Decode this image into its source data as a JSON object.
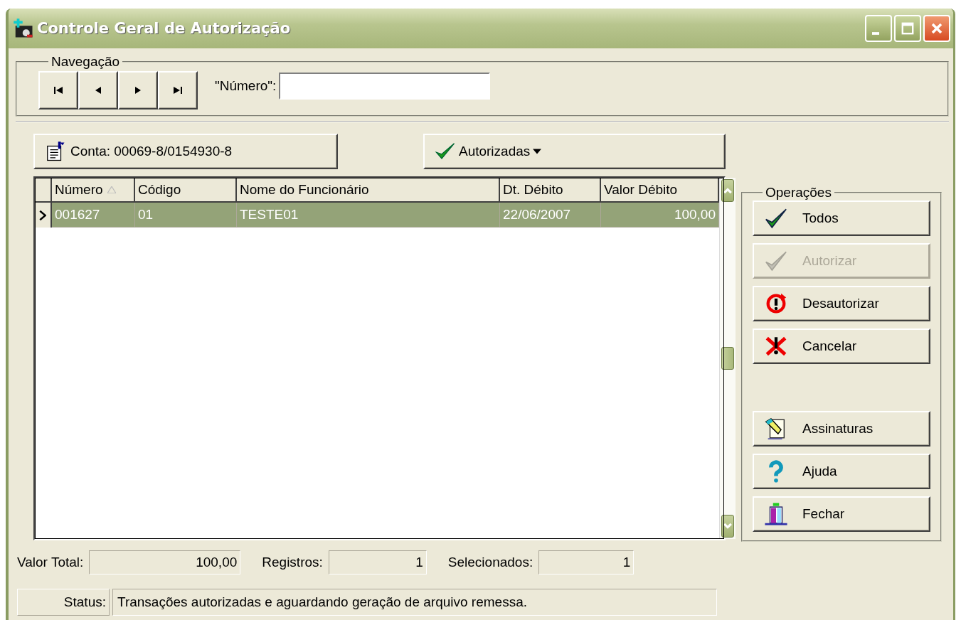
{
  "window": {
    "title": "Controle Geral de Autorização"
  },
  "navigation": {
    "title": "Navegação",
    "buttons": [
      {
        "kind": "first"
      },
      {
        "kind": "prev"
      },
      {
        "kind": "next"
      },
      {
        "kind": "last"
      }
    ],
    "number_field": {
      "label": "\"Número\":"
    }
  },
  "account_button": {
    "label": "Conta: 00069-8/0154930-8"
  },
  "filter_button": {
    "label": "Autorizadas"
  },
  "table": {
    "columns": [
      {
        "label": "Número",
        "sorted": true
      },
      {
        "label": "Código",
        "sorted": false
      },
      {
        "label": "Nome do Funcionário",
        "sorted": false
      },
      {
        "label": "Dt. Débito",
        "sorted": false
      },
      {
        "label": "Valor Débito",
        "sorted": false
      }
    ],
    "rows": [
      {
        "selected": true,
        "cells": [
          "001627",
          "01",
          "TESTE01",
          "22/06/2007",
          "100,00"
        ]
      }
    ]
  },
  "operations": {
    "title": "Operações",
    "buttons": [
      {
        "label": "Todos",
        "kind": "check",
        "disabled": false,
        "gap": false
      },
      {
        "label": "Autorizar",
        "kind": "check",
        "disabled": true,
        "gap": false
      },
      {
        "label": "Desautorizar",
        "kind": "undo",
        "disabled": false,
        "gap": false
      },
      {
        "label": "Cancelar",
        "kind": "cross",
        "disabled": false,
        "gap": false
      },
      {
        "label": "Assinaturas",
        "kind": "sign",
        "disabled": false,
        "gap": true
      },
      {
        "label": "Ajuda",
        "kind": "help",
        "disabled": false,
        "gap": false
      },
      {
        "label": "Fechar",
        "kind": "exit",
        "disabled": false,
        "gap": false
      }
    ]
  },
  "totals": [
    {
      "label": "Valor Total:",
      "value": "100,00"
    },
    {
      "label": "Registros:",
      "value": "1"
    },
    {
      "label": "Selecionados:",
      "value": "1"
    }
  ],
  "status_bar": {
    "label": "Status:",
    "message": "Transações autorizadas e aguardando geração de arquivo remessa."
  }
}
